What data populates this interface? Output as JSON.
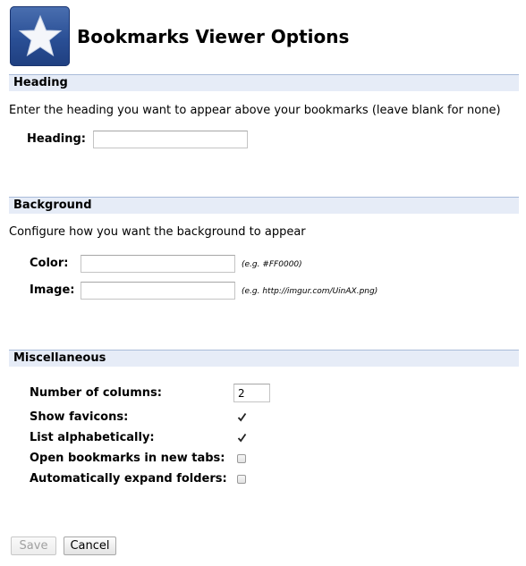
{
  "header": {
    "title": "Bookmarks Viewer Options",
    "logo_icon": "star-icon"
  },
  "sections": {
    "heading": {
      "title": "Heading",
      "description": "Enter the heading you want to appear above your bookmarks (leave blank for none)",
      "field_label": "Heading:",
      "field_value": ""
    },
    "background": {
      "title": "Background",
      "description": "Configure how you want the background to appear",
      "color_label": "Color:",
      "color_value": "",
      "color_hint": "(e.g. #FF0000)",
      "image_label": "Image:",
      "image_value": "",
      "image_hint": "(e.g. http://imgur.com/UinAX.png)"
    },
    "misc": {
      "title": "Miscellaneous",
      "columns_label": "Number of columns:",
      "columns_value": "2",
      "show_favicons_label": "Show favicons:",
      "show_favicons_checked": true,
      "list_alpha_label": "List alphabetically:",
      "list_alpha_checked": true,
      "new_tabs_label": "Open bookmarks in new tabs:",
      "new_tabs_checked": false,
      "expand_folders_label": "Automatically expand folders:",
      "expand_folders_checked": false
    }
  },
  "buttons": {
    "save_label": "Save",
    "save_disabled": true,
    "cancel_label": "Cancel"
  },
  "colors": {
    "section_header_bg": "#e6ecf7",
    "section_header_border": "#a9bbd9",
    "logo_blue": "#2a4f95"
  }
}
